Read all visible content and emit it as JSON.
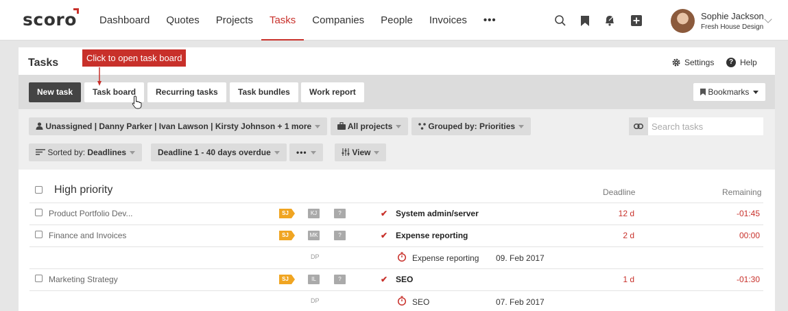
{
  "brand": {
    "logo_text": "scoro",
    "accent": "#c8302a"
  },
  "nav": {
    "items": [
      "Dashboard",
      "Quotes",
      "Projects",
      "Tasks",
      "Companies",
      "People",
      "Invoices",
      "•••"
    ],
    "active": "Tasks",
    "icons": [
      "search-icon",
      "bookmark-icon",
      "bell-icon",
      "plus-square-icon"
    ]
  },
  "user": {
    "name": "Sophie Jackson",
    "company": "Fresh House Design"
  },
  "page": {
    "title": "Tasks",
    "settings_label": "Settings",
    "help_label": "Help"
  },
  "tooltip": {
    "text": "Click to open task board"
  },
  "toolbar": {
    "buttons": [
      "New task",
      "Task board",
      "Recurring tasks",
      "Task bundles",
      "Work report"
    ],
    "bookmarks_label": "Bookmarks"
  },
  "filters": {
    "assignees": "Unassigned | Danny Parker | Ivan Lawson | Kirsty Johnson + 1 more",
    "projects": "All projects",
    "grouped_prefix": "Grouped by:",
    "grouped_value": "Priorities",
    "sorted_prefix": "Sorted by:",
    "sorted_value": "Deadlines",
    "deadline_range": "Deadline 1 - 40 days overdue",
    "more": "•••",
    "view": "View",
    "search_placeholder": "Search tasks"
  },
  "table": {
    "group_title": "High priority",
    "col_deadline": "Deadline",
    "col_remaining": "Remaining",
    "rows": [
      {
        "project": "Product Portfolio Dev...",
        "owner": "SJ",
        "assignee": "KJ",
        "extra": "?",
        "task": "System admin/server",
        "deadline": "12 d",
        "remaining": "-01:45"
      },
      {
        "project": "Finance and Invoices",
        "owner": "SJ",
        "assignee": "MK",
        "extra": "?",
        "task": "Expense reporting",
        "deadline": "2 d",
        "remaining": "00:00"
      },
      {
        "sub": true,
        "assignee": "DP",
        "task": "Expense reporting",
        "date": "09. Feb 2017"
      },
      {
        "project": "Marketing Strategy",
        "owner": "SJ",
        "assignee": "IL",
        "extra": "?",
        "task": "SEO",
        "deadline": "1 d",
        "remaining": "-01:30"
      },
      {
        "sub": true,
        "assignee": "DP",
        "task": "SEO",
        "date": "07. Feb 2017"
      }
    ]
  }
}
